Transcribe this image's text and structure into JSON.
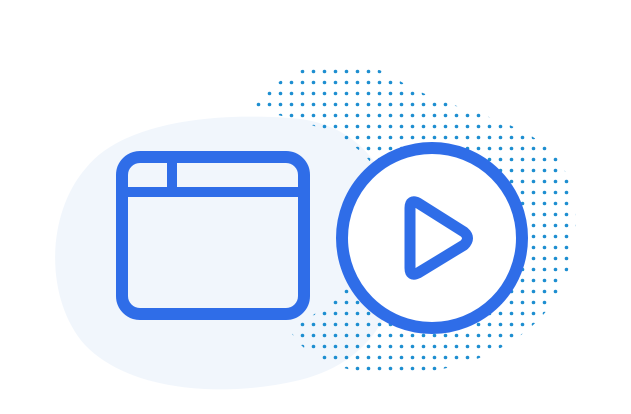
{
  "illustration": {
    "icons": [
      "browser-window-icon",
      "play-circle-icon"
    ],
    "colors": {
      "accent": "#2f6de8",
      "blob": "#f1f6fc",
      "dots": "#1d8ed0",
      "background": "#ffffff"
    }
  }
}
